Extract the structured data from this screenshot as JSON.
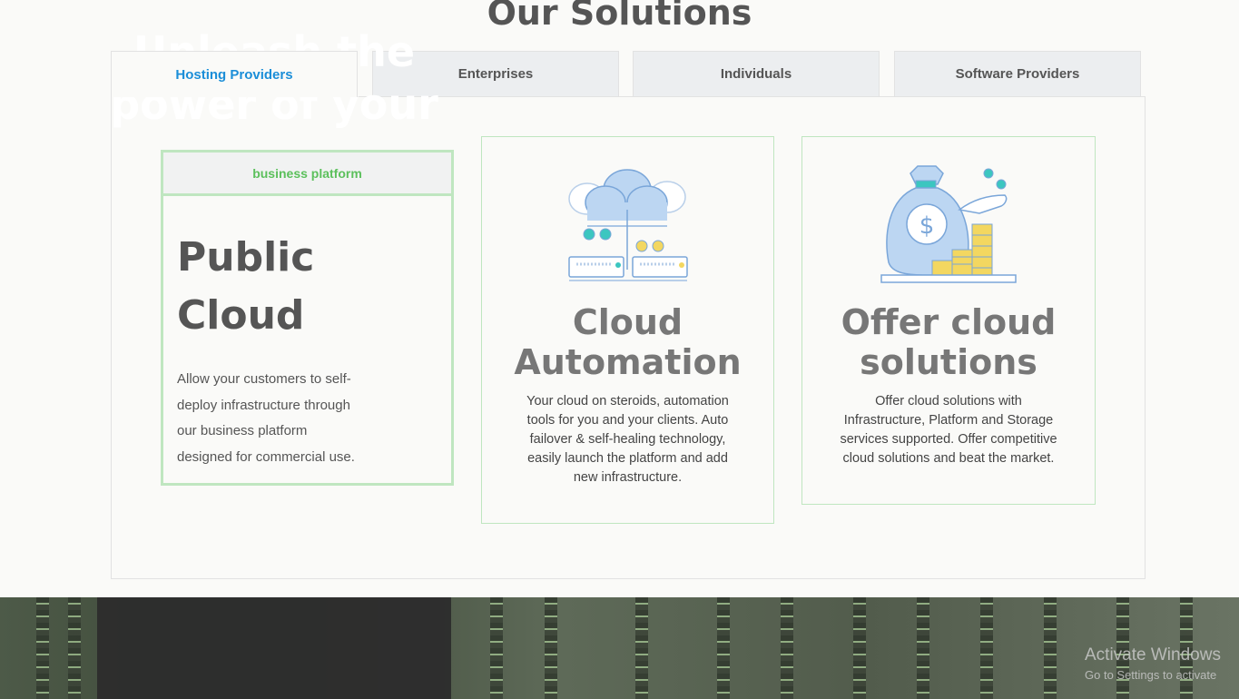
{
  "section": {
    "title": "Our Solutions"
  },
  "tabs": [
    {
      "label": "Hosting Providers",
      "active": true
    },
    {
      "label": "Enterprises",
      "active": false
    },
    {
      "label": "Individuals",
      "active": false
    },
    {
      "label": "Software Providers",
      "active": false
    }
  ],
  "cards": {
    "public_cloud": {
      "header": "business platform",
      "title_line1": "Public",
      "title_line2": "Cloud",
      "desc_line1": "Allow your customers to self-",
      "desc_line2": "deploy infrastructure through",
      "desc_line3": "our business platform",
      "desc_line4": "designed for commercial use."
    },
    "cloud_automation": {
      "title_line1": "Cloud",
      "title_line2": "Automation",
      "text": "Your cloud on steroids, automation tools for you and your clients. Auto failover & self-healing technology, easily launch the platform and add new infrastructure.",
      "icon": "cloud-server-icon"
    },
    "offer_cloud": {
      "title_line1": "Offer cloud",
      "title_line2": "solutions",
      "text": "Offer cloud solutions with Infrastructure, Platform and Storage services supported. Offer competitive cloud solutions and beat the market.",
      "icon": "money-bag-icon"
    }
  },
  "banner": {
    "title": "Unleash the power of your"
  },
  "os_watermark": {
    "title": "Activate Windows",
    "sub": "Go to Settings to activate"
  },
  "colors": {
    "accent_blue": "#1b8ed8",
    "accent_green": "#5cc05c",
    "border_green": "#bfe6c0"
  }
}
